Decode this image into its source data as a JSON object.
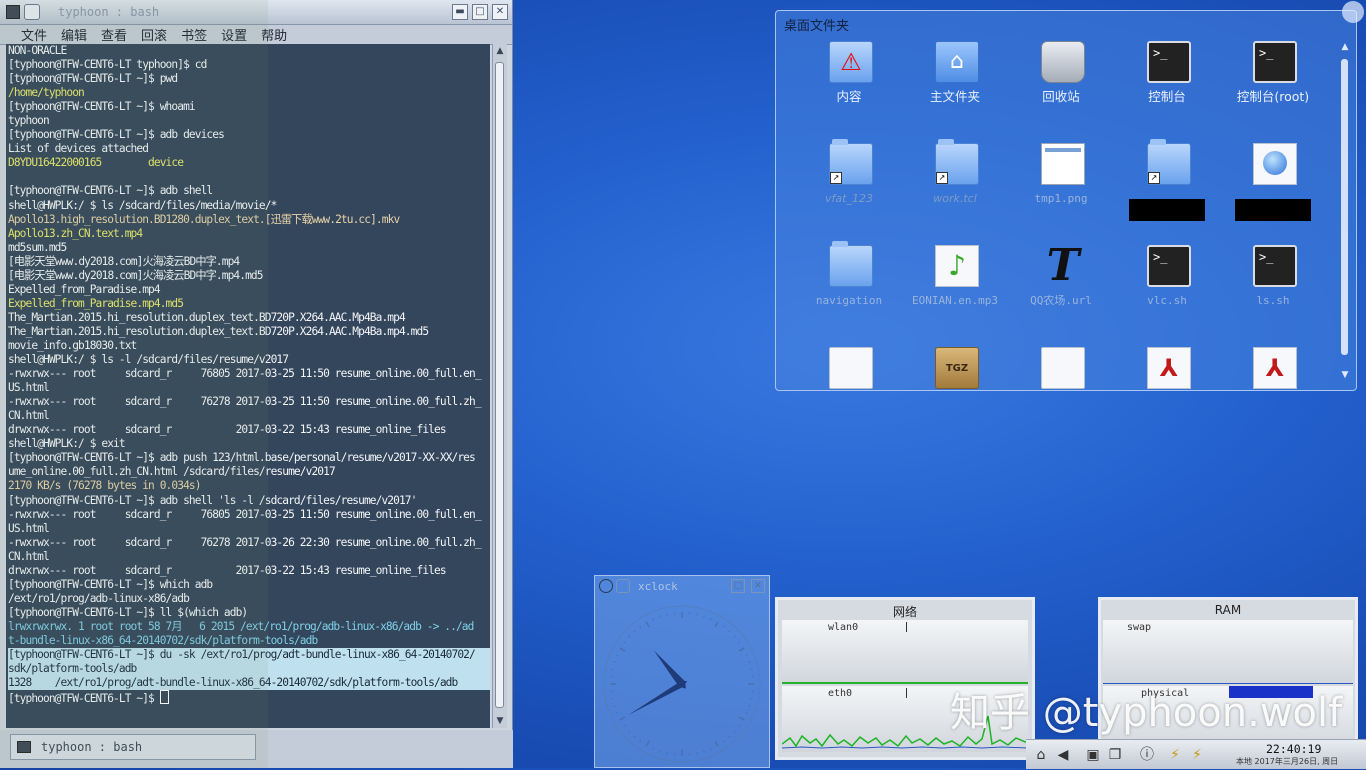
{
  "terminal": {
    "title": "typhoon : bash",
    "menu": [
      "文件",
      "编辑",
      "查看",
      "回滚",
      "书签",
      "设置",
      "帮助"
    ],
    "status_tab": "typhoon : bash",
    "lines": [
      {
        "t": "NON-ORACLE",
        "c": ""
      },
      {
        "t": "[typhoon@TFW-CENT6-LT typhoon]$ cd",
        "c": ""
      },
      {
        "t": "[typhoon@TFW-CENT6-LT ~]$ pwd",
        "c": ""
      },
      {
        "t": "/home/typhoon",
        "c": "y"
      },
      {
        "t": "[typhoon@TFW-CENT6-LT ~]$ whoami",
        "c": ""
      },
      {
        "t": "typhoon",
        "c": ""
      },
      {
        "t": "[typhoon@TFW-CENT6-LT ~]$ adb devices",
        "c": ""
      },
      {
        "t": "List of devices attached",
        "c": ""
      },
      {
        "t": "D8YDU16422000165        device",
        "c": "y"
      },
      {
        "t": "",
        "c": ""
      },
      {
        "t": "[typhoon@TFW-CENT6-LT ~]$ adb shell",
        "c": ""
      },
      {
        "t": "shell@HWPLK:/ $ ls /sdcard/files/media/movie/*",
        "c": ""
      },
      {
        "t": "Apollo13.high_resolution.BD1280.duplex_text.[迅雷下载www.2tu.cc].mkv",
        "c": "o"
      },
      {
        "t": "Apollo13.zh_CN.text.mp4",
        "c": "y"
      },
      {
        "t": "md5sum.md5",
        "c": ""
      },
      {
        "t": "[电影天堂www.dy2018.com]火海凌云BD中字.mp4",
        "c": ""
      },
      {
        "t": "[电影天堂www.dy2018.com]火海凌云BD中字.mp4.md5",
        "c": ""
      },
      {
        "t": "Expelled_from_Paradise.mp4",
        "c": ""
      },
      {
        "t": "Expelled_from_Paradise.mp4.md5",
        "c": "y"
      },
      {
        "t": "The_Martian.2015.hi_resolution.duplex_text.BD720P.X264.AAC.Mp4Ba.mp4",
        "c": ""
      },
      {
        "t": "The_Martian.2015.hi_resolution.duplex_text.BD720P.X264.AAC.Mp4Ba.mp4.md5",
        "c": ""
      },
      {
        "t": "movie_info.gb18030.txt",
        "c": ""
      },
      {
        "t": "shell@HWPLK:/ $ ls -l /sdcard/files/resume/v2017",
        "c": ""
      },
      {
        "t": "-rwxrwx--- root     sdcard_r     76805 2017-03-25 11:50 resume_online.00_full.en_",
        "c": ""
      },
      {
        "t": "US.html",
        "c": ""
      },
      {
        "t": "-rwxrwx--- root     sdcard_r     76278 2017-03-25 11:50 resume_online.00_full.zh_",
        "c": ""
      },
      {
        "t": "CN.html",
        "c": ""
      },
      {
        "t": "drwxrwx--- root     sdcard_r           2017-03-22 15:43 resume_online_files",
        "c": ""
      },
      {
        "t": "shell@HWPLK:/ $ exit",
        "c": ""
      },
      {
        "t": "[typhoon@TFW-CENT6-LT ~]$ adb push 123/html.base/personal/resume/v2017-XX-XX/res",
        "c": ""
      },
      {
        "t": "ume_online.00_full.zh_CN.html /sdcard/files/resume/v2017",
        "c": ""
      },
      {
        "t": "2170 KB/s (76278 bytes in 0.034s)",
        "c": "o"
      },
      {
        "t": "[typhoon@TFW-CENT6-LT ~]$ adb shell 'ls -l /sdcard/files/resume/v2017'",
        "c": ""
      },
      {
        "t": "-rwxrwx--- root     sdcard_r     76805 2017-03-25 11:50 resume_online.00_full.en_",
        "c": ""
      },
      {
        "t": "US.html",
        "c": ""
      },
      {
        "t": "-rwxrwx--- root     sdcard_r     76278 2017-03-26 22:30 resume_online.00_full.zh_",
        "c": ""
      },
      {
        "t": "CN.html",
        "c": ""
      },
      {
        "t": "drwxrwx--- root     sdcard_r           2017-03-22 15:43 resume_online_files",
        "c": ""
      },
      {
        "t": "[typhoon@TFW-CENT6-LT ~]$ which adb",
        "c": ""
      },
      {
        "t": "/ext/ro1/prog/adb-linux-x86/adb",
        "c": ""
      },
      {
        "t": "[typhoon@TFW-CENT6-LT ~]$ ll $(which adb)",
        "c": ""
      },
      {
        "t": "lrwxrwxrwx. 1 root root 58 7月   6 2015 /ext/ro1/prog/adb-linux-x86/adb -> ../ad",
        "c": "c"
      },
      {
        "t": "t-bundle-linux-x86_64-20140702/sdk/platform-tools/adb",
        "c": "c"
      },
      {
        "t": "[typhoon@TFW-CENT6-LT ~]$ du -sk /ext/ro1/prog/adt-bundle-linux-x86_64-20140702/",
        "c": "hl"
      },
      {
        "t": "sdk/platform-tools/adb",
        "c": "hl"
      },
      {
        "t": "1328    /ext/ro1/prog/adt-bundle-linux-x86_64-20140702/sdk/platform-tools/adb",
        "c": "hl"
      },
      {
        "t": "[typhoon@TFW-CENT6-LT ~]$ ",
        "c": "cursor"
      }
    ]
  },
  "folder": {
    "title": "桌面文件夹",
    "icons": [
      {
        "label": "内容",
        "icon": "warning-folder-icon",
        "style": ""
      },
      {
        "label": "主文件夹",
        "icon": "home-folder-icon",
        "style": ""
      },
      {
        "label": "回收站",
        "icon": "trash-icon",
        "style": ""
      },
      {
        "label": "控制台",
        "icon": "terminal-icon",
        "style": ""
      },
      {
        "label": "控制台(root)",
        "icon": "terminal-icon",
        "style": ""
      },
      {
        "label": "vfat_123",
        "icon": "folder-link-icon",
        "style": "dim"
      },
      {
        "label": "work.tcl",
        "icon": "folder-link-icon",
        "style": "dim"
      },
      {
        "label": "tmp1.png",
        "icon": "image-file-icon",
        "style": "mono"
      },
      {
        "label": "",
        "icon": "folder-link-icon",
        "style": "redacted"
      },
      {
        "label": "",
        "icon": "globe-file-icon",
        "style": "redacted"
      },
      {
        "label": "navigation",
        "icon": "folder-icon",
        "style": "mono"
      },
      {
        "label": "EONIAN.en.mp3",
        "icon": "music-file-icon",
        "style": "mono"
      },
      {
        "label": "QQ农场.url",
        "icon": "font-file-icon",
        "style": "mono"
      },
      {
        "label": "vlc.sh",
        "icon": "shell-script-icon",
        "style": "mono"
      },
      {
        "label": "ls.sh",
        "icon": "shell-script-icon",
        "style": "mono"
      },
      {
        "label": "",
        "icon": "text-file-icon",
        "style": ""
      },
      {
        "label": "",
        "icon": "tgz-archive-icon",
        "style": ""
      },
      {
        "label": "",
        "icon": "text-file-icon",
        "style": ""
      },
      {
        "label": "",
        "icon": "pdf-file-icon",
        "style": ""
      },
      {
        "label": "",
        "icon": "pdf-file-icon",
        "style": ""
      }
    ]
  },
  "xclock": {
    "title": "xclock",
    "time": {
      "hour": 10,
      "minute": 40
    }
  },
  "network_monitor": {
    "title": "网络",
    "interfaces": [
      "wlan0",
      "eth0"
    ]
  },
  "ram_monitor": {
    "title": "RAM",
    "rows": [
      "swap",
      "physical"
    ]
  },
  "tray": {
    "time": "22:40:19",
    "date": "本地 2017年三月26日, 周日"
  },
  "watermark": "知乎 @typhoon.wolf",
  "colors": {
    "terminal_bg": "#34465c",
    "highlight": "#bfe0ee",
    "desktop": "#2462cf"
  }
}
